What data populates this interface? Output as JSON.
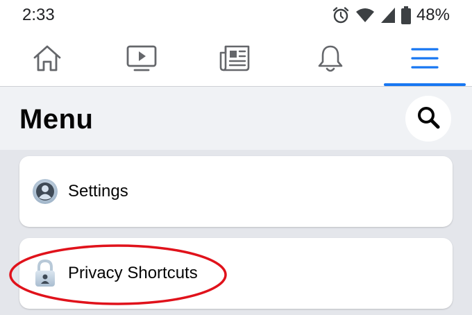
{
  "status_bar": {
    "time": "2:33",
    "battery_percent": "48%",
    "icons": [
      "alarm-icon",
      "wifi-icon",
      "signal-icon",
      "battery-icon"
    ]
  },
  "nav": {
    "items": [
      {
        "name": "home",
        "icon": "home-icon",
        "active": false
      },
      {
        "name": "watch",
        "icon": "video-icon",
        "active": false
      },
      {
        "name": "news",
        "icon": "newspaper-icon",
        "active": false
      },
      {
        "name": "notifications",
        "icon": "bell-icon",
        "active": false
      },
      {
        "name": "menu",
        "icon": "hamburger-menu-icon",
        "active": true
      }
    ],
    "accent_color": "#1877f2"
  },
  "menu": {
    "title": "Menu",
    "search_icon": "search-icon",
    "items": [
      {
        "label": "Settings",
        "icon": "user-circle-icon"
      },
      {
        "label": "Privacy Shortcuts",
        "icon": "lock-icon"
      }
    ]
  },
  "annotation": {
    "shape": "ellipse",
    "color": "#e0121b",
    "target": "Privacy Shortcuts"
  }
}
